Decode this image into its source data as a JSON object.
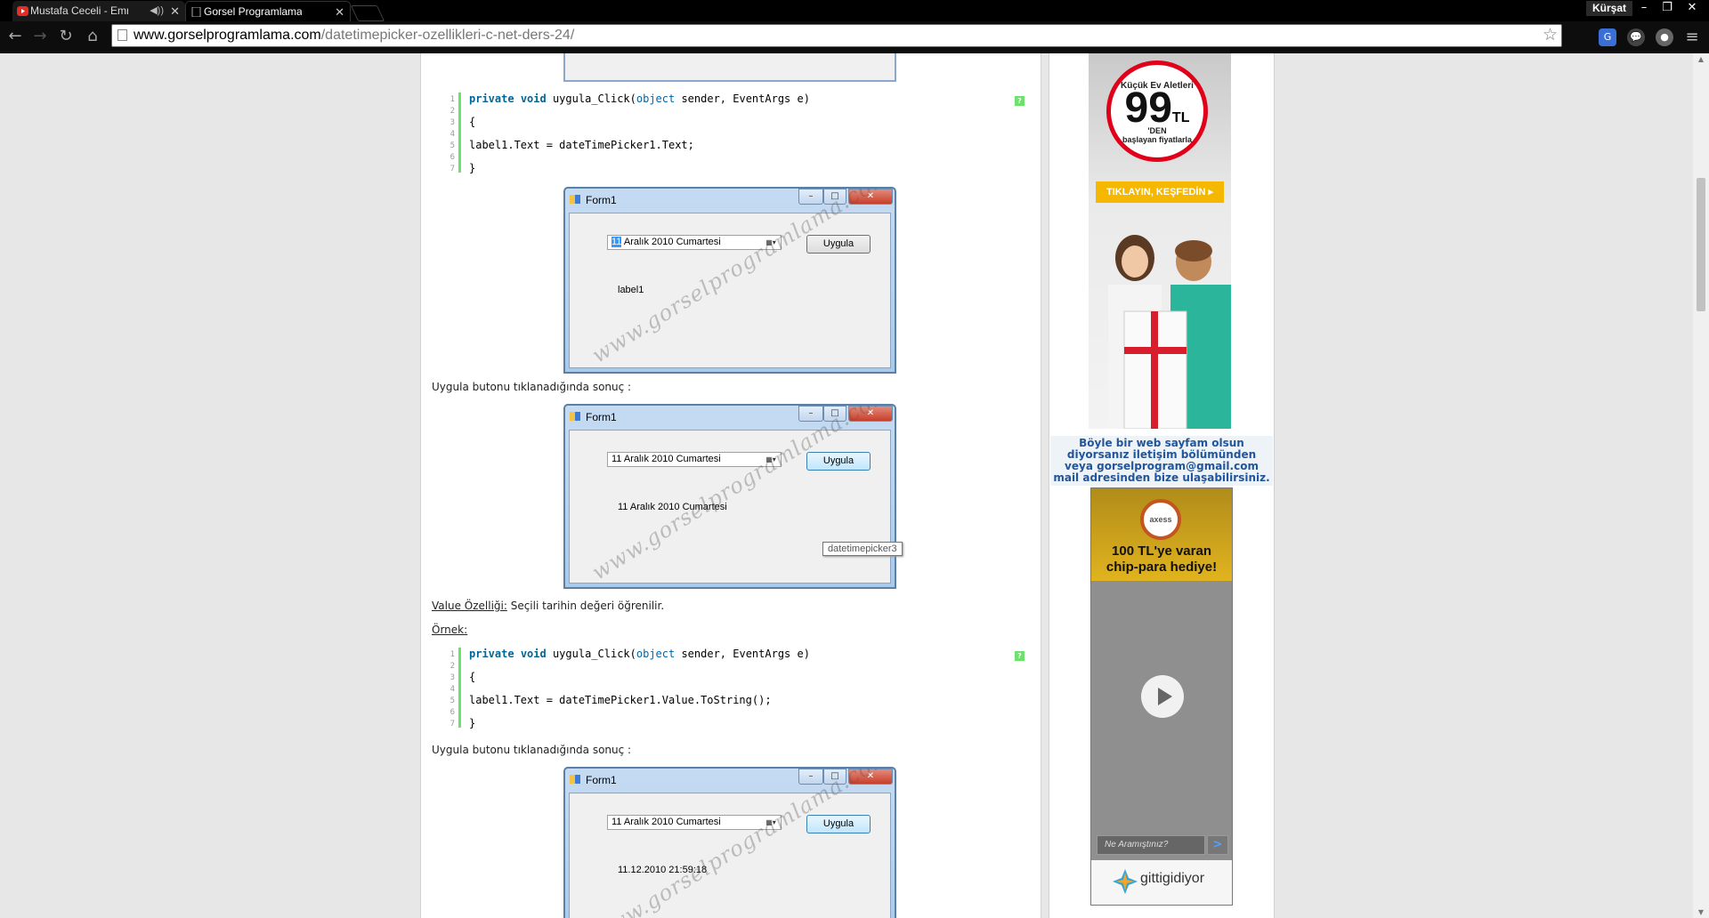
{
  "browser": {
    "tabs": [
      {
        "title": "Mustafa Ceceli - Emri C",
        "active": false,
        "audio_icon": "speaker-icon"
      },
      {
        "title": "Gorsel Programlama » dat",
        "active": true
      }
    ],
    "profile_name": "Kürşat",
    "url_host": "www.gorselprogramlama.com",
    "url_path": "/datetimepicker-ozellikleri-c-net-ders-24/"
  },
  "content": {
    "code_block_1": {
      "line_numbers": [
        "1",
        "2",
        "3",
        "4",
        "5",
        "6",
        "7"
      ],
      "lines": [
        {
          "kw1": "private",
          "kw2": "void",
          "rest": " uygula_Click(",
          "type": "object",
          "tail": " sender, EventArgs e)"
        },
        {
          "text": "{"
        },
        {
          "text": "label1.Text = dateTimePicker1.Text;"
        },
        {
          "text": "}"
        }
      ]
    },
    "form_1": {
      "title": "Form1",
      "date_day": "11",
      "date_rest": "  Aralık   2010 Cumartesi",
      "button": "Uygula",
      "label": "label1",
      "watermark": "www.gorselprogramlama.com"
    },
    "result_caption_1": "Uygula butonu tıklanadığında sonuç :",
    "form_2": {
      "title": "Form1",
      "date_day": "11",
      "date_rest": "  Aralık   2010 Cumartesi",
      "button": "Uygula",
      "label": "11 Aralık 2010 Cumartesi",
      "watermark": "www.gorselprogramlama.com",
      "tooltip": "datetimepicker3"
    },
    "value_property": {
      "term": "Value Özelliği:",
      "description": " Seçili tarihin değeri öğrenilir."
    },
    "example_label": "Örnek:",
    "code_block_2": {
      "line_numbers": [
        "1",
        "2",
        "3",
        "4",
        "5",
        "6",
        "7"
      ],
      "lines": [
        {
          "kw1": "private",
          "kw2": "void",
          "rest": " uygula_Click(",
          "type": "object",
          "tail": " sender, EventArgs e)"
        },
        {
          "text": "{"
        },
        {
          "text": "label1.Text = dateTimePicker1.Value.ToString();"
        },
        {
          "text": "}"
        }
      ]
    },
    "result_caption_2": "Uygula butonu tıklanadığında sonuç :",
    "form_3": {
      "title": "Form1",
      "date_day": "11",
      "date_rest": "  Aralık   2010 Cumartesi",
      "button": "Uygula",
      "label": "11.12.2010 21:59:18",
      "watermark": "www.gorselprogramlama.com"
    },
    "help_icon_text": "?"
  },
  "sidebar": {
    "ad1": {
      "heading": "Küçük Ev Aletleri",
      "price": "99",
      "currency": "TL",
      "suffix": "'DEN",
      "subtext": "başlayan fiyatlarla",
      "cta": "TIKLAYIN, KEŞFEDİN ▸"
    },
    "contact_lines": [
      "Böyle bir web sayfam olsun",
      "diyorsanız iletişim bölümünden",
      "veya gorselprogram@gmail.com",
      "mail adresinden bize ulaşabilirsiniz."
    ],
    "ad2": {
      "logo": "axess",
      "headline_1": "100 TL'ye varan",
      "headline_2": "chip-para hediye!",
      "search_placeholder": "Ne Aramıştınız?",
      "search_go": ">",
      "brand": "gittigidiyor"
    }
  },
  "colors": {
    "code_keyword": "#006699",
    "code_gutter": "#6ce26c",
    "sidebar_note": "#225599",
    "ad_red": "#e1001a",
    "ad_yellow": "#f5b700"
  }
}
